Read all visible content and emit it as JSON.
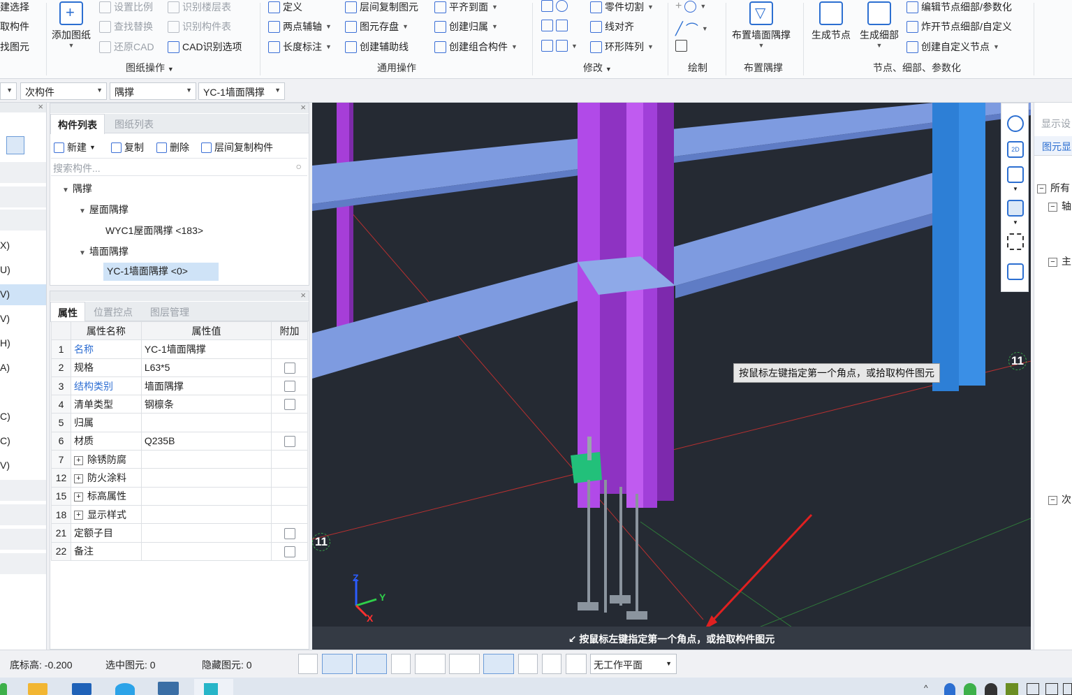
{
  "ribbon": {
    "col1": [
      "建选择",
      "取构件",
      "找图元"
    ],
    "add_drawing": "添加图纸",
    "drawing_ops": [
      "设置比例",
      "查找替换",
      "还原CAD",
      "识别楼层表",
      "识别构件表",
      "CAD识别选项"
    ],
    "drawing_ops_label": "图纸操作",
    "general_ops": [
      "定义",
      "两点辅轴",
      "长度标注",
      "层间复制图元",
      "图元存盘",
      "创建辅助线",
      "平齐到面",
      "创建归属",
      "创建组合构件"
    ],
    "general_ops_label": "通用操作",
    "modify": [
      "零件切割",
      "线对齐",
      "环形阵列"
    ],
    "modify_label": "修改",
    "draw_label": "绘制",
    "place_brace": "布置墙面隅撑",
    "place_brace_label": "布置隅撑",
    "gen_node": "生成节点",
    "gen_detail": "生成细部",
    "node_ops": [
      "编辑节点细部/参数化",
      "炸开节点细部/自定义",
      "创建自定义节点"
    ],
    "node_label": "节点、细部、参数化"
  },
  "combos": [
    "次构件",
    "隅撑",
    "YC-1墙面隅撑"
  ],
  "left_strip": [
    "X)",
    "U)",
    "V)",
    "V)",
    "H)",
    "A)",
    "C)",
    "C)",
    "V)"
  ],
  "component_panel": {
    "tabs": [
      "构件列表",
      "图纸列表"
    ],
    "toolbar": [
      "新建",
      "复制",
      "删除",
      "层间复制构件"
    ],
    "search_placeholder": "搜索构件...",
    "tree": [
      {
        "label": "隅撑",
        "level": 0
      },
      {
        "label": "屋面隅撑",
        "level": 1
      },
      {
        "label": "WYC1屋面隅撑 <183>",
        "level": 2
      },
      {
        "label": "墙面隅撑",
        "level": 1
      },
      {
        "label": "YC-1墙面隅撑 <0>",
        "level": 2,
        "selected": true
      }
    ]
  },
  "property_panel": {
    "tabs": [
      "属性",
      "位置控点",
      "图层管理"
    ],
    "headers": [
      "属性名称",
      "属性值",
      "附加"
    ],
    "rows": [
      {
        "num": "1",
        "name": "名称",
        "value": "YC-1墙面隅撑",
        "blue": true,
        "check": false,
        "expand": false
      },
      {
        "num": "2",
        "name": "规格",
        "value": "L63*5",
        "blue": false,
        "check": true,
        "expand": false
      },
      {
        "num": "3",
        "name": "结构类别",
        "value": "墙面隅撑",
        "blue": true,
        "check": true,
        "expand": false
      },
      {
        "num": "4",
        "name": "清单类型",
        "value": "钢檩条",
        "blue": false,
        "check": true,
        "expand": false
      },
      {
        "num": "5",
        "name": "归属",
        "value": "",
        "blue": false,
        "check": false,
        "expand": false
      },
      {
        "num": "6",
        "name": "材质",
        "value": "Q235B",
        "blue": false,
        "check": true,
        "expand": false
      },
      {
        "num": "7",
        "name": "除锈防腐",
        "value": "",
        "blue": false,
        "check": false,
        "expand": true
      },
      {
        "num": "12",
        "name": "防火涂料",
        "value": "",
        "blue": false,
        "check": false,
        "expand": true
      },
      {
        "num": "15",
        "name": "标高属性",
        "value": "",
        "blue": false,
        "check": false,
        "expand": true
      },
      {
        "num": "18",
        "name": "显示样式",
        "value": "",
        "blue": false,
        "check": false,
        "expand": true
      },
      {
        "num": "21",
        "name": "定额子目",
        "value": "",
        "blue": false,
        "check": true,
        "expand": false
      },
      {
        "num": "22",
        "name": "备注",
        "value": "",
        "blue": false,
        "check": true,
        "expand": false
      }
    ]
  },
  "viewport": {
    "tooltip": "按鼠标左键指定第一个角点，或拾取构件图元",
    "status": "按鼠标左键指定第一个角点，或拾取构件图元",
    "axis_label": "11",
    "axis_z": "Z",
    "axis_y": "Y",
    "axis_x": "X"
  },
  "right_panel": {
    "title": "显示设",
    "tab": "图元显",
    "items": [
      "所有",
      "轴",
      "主",
      "次"
    ]
  },
  "status_bar": {
    "base_elev": "底标高: -0.200",
    "selected": "选中图元: 0",
    "hidden": "隐藏图元: 0",
    "work_plane": "无工作平面"
  },
  "colors": {
    "accent": "#2c6fd1",
    "purple_column": "#b14ae8",
    "beam": "#7f9fe0",
    "blue_column": "#2d7fd6",
    "viewport_bg": "#252a33"
  }
}
